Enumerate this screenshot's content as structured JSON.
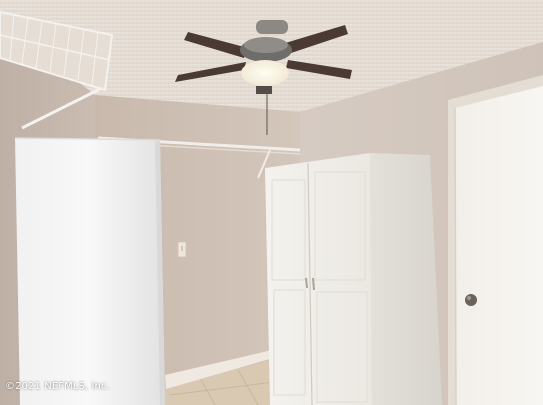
{
  "photo": {
    "watermark": "©2021 NEFMLS, Inc."
  }
}
